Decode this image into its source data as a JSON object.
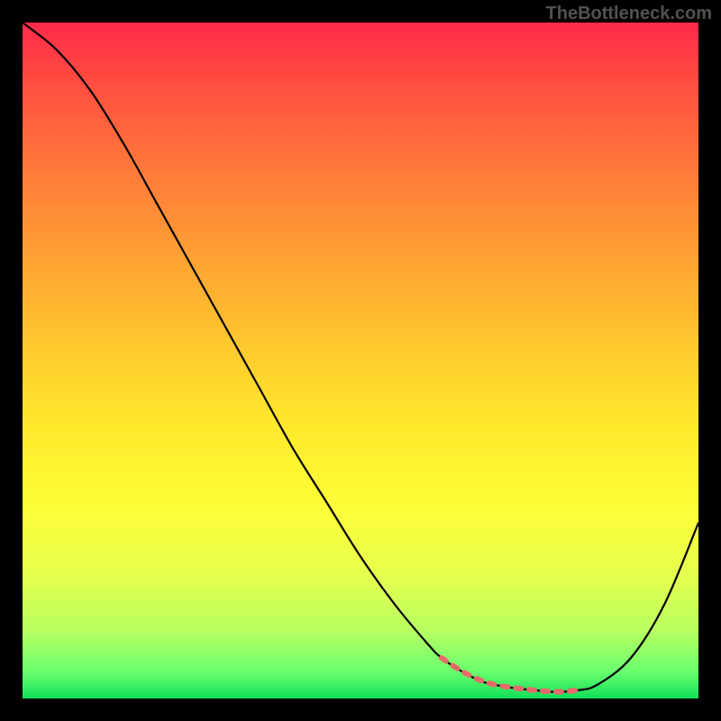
{
  "watermark": "TheBottleneck.com",
  "chart_data": {
    "type": "line",
    "title": "",
    "xlabel": "",
    "ylabel": "",
    "xlim": [
      0,
      100
    ],
    "ylim": [
      0,
      100
    ],
    "x": [
      0,
      5,
      10,
      15,
      20,
      25,
      30,
      35,
      40,
      45,
      50,
      55,
      60,
      62,
      65,
      68,
      70,
      73,
      76,
      78,
      80,
      82,
      85,
      90,
      95,
      100
    ],
    "values": [
      100,
      96,
      90,
      82,
      73,
      64,
      55,
      46,
      37,
      29,
      21,
      14,
      8,
      6,
      4,
      2.5,
      2,
      1.5,
      1.2,
      1,
      1,
      1.2,
      2,
      6,
      14,
      26
    ],
    "flat_segment_x": [
      62,
      82
    ],
    "flat_segment_color": "#e86a6a",
    "curve_color": "#000000"
  }
}
